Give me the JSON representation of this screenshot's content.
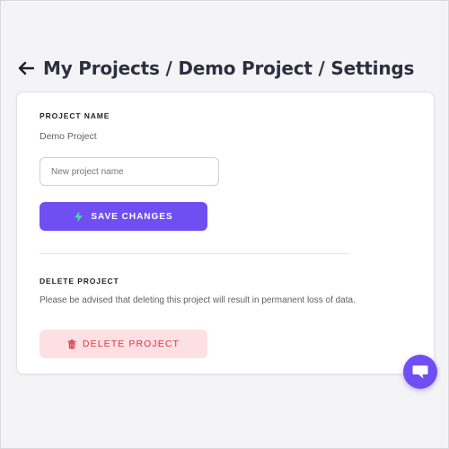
{
  "header": {
    "title": "My Projects / Demo Project / Settings",
    "back_icon": "arrow-left-icon"
  },
  "project_name": {
    "label": "PROJECT NAME",
    "current_value": "Demo Project",
    "input_value": "",
    "input_placeholder": "New project name",
    "save_label": "SAVE CHANGES",
    "save_icon": "lightning-icon"
  },
  "delete_project": {
    "label": "DELETE PROJECT",
    "description": "Please be advised that deleting this project will result in permanent loss of data.",
    "button_label": "DELETE PROJECT",
    "button_icon": "trash-icon"
  },
  "chat": {
    "icon": "chat-icon"
  },
  "colors": {
    "accent": "#6f4ff2",
    "lightning": "#3fe0a0",
    "danger": "#e0343f",
    "danger_bg": "#fde0e4"
  }
}
